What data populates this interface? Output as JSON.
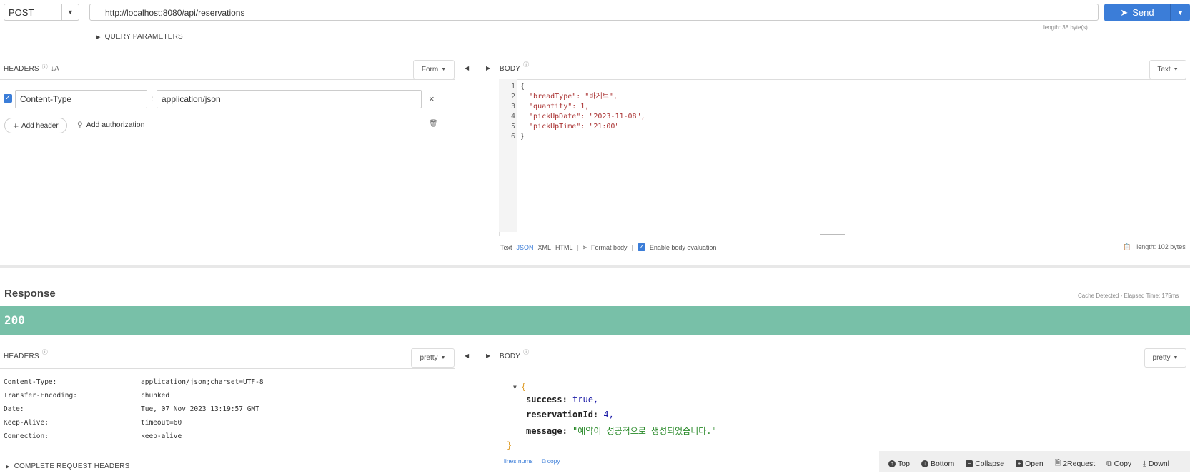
{
  "request": {
    "method": "POST",
    "url": "http://localhost:8080/api/reservations",
    "url_length": "length: 38 byte(s)",
    "send_label": "Send",
    "query_params_label": "QUERY PARAMETERS"
  },
  "req_headers": {
    "title": "HEADERS",
    "mode": "Form",
    "header_name": "Content-Type",
    "header_value": "application/json",
    "add_header_label": "Add header",
    "add_auth_label": "Add authorization"
  },
  "req_body": {
    "title": "BODY",
    "mode": "Text",
    "lines": [
      {
        "num": "1",
        "text": "{"
      },
      {
        "num": "2",
        "text": "  \"breadType\": \"바게트\","
      },
      {
        "num": "3",
        "text": "  \"quantity\": 1,"
      },
      {
        "num": "4",
        "text": "  \"pickUpDate\": \"2023-11-08\","
      },
      {
        "num": "5",
        "text": "  \"pickUpTime\": \"21:00\""
      },
      {
        "num": "6",
        "text": "}"
      }
    ],
    "format_types": [
      "Text",
      "JSON",
      "XML",
      "HTML"
    ],
    "format_body_label": "Format body",
    "eval_label": "Enable body evaluation",
    "length": "length: 102 bytes"
  },
  "response": {
    "title": "Response",
    "cache_info": "Cache Detected - Elapsed Time: 175ms",
    "status_code": "200",
    "headers_title": "HEADERS",
    "headers_mode": "pretty",
    "headers": [
      {
        "key": "Content-Type:",
        "value": "application/json;charset=UTF-8"
      },
      {
        "key": "Transfer-Encoding:",
        "value": "chunked"
      },
      {
        "key": "Date:",
        "value": "Tue, 07 Nov 2023 13:19:57 GMT"
      },
      {
        "key": "Keep-Alive:",
        "value": "timeout=60"
      },
      {
        "key": "Connection:",
        "value": "keep-alive"
      }
    ],
    "complete_headers_label": "COMPLETE REQUEST HEADERS",
    "body_title": "BODY",
    "body_mode": "pretty",
    "json": {
      "open": "{",
      "close": "}",
      "success_key": "success:",
      "success_val": "true,",
      "id_key": "reservationId:",
      "id_val": "4,",
      "message_key": "message:",
      "message_val": "\"예약이 성공적으로 생성되었습니다.\""
    },
    "lines_nums_label": "lines nums",
    "copy_label": "copy",
    "toolbar": [
      "Top",
      "Bottom",
      "Collapse",
      "Open",
      "2Request",
      "Copy",
      "Downl"
    ]
  },
  "colors": {
    "accent": "#3b7dd8",
    "status_ok": "#78c0a8"
  }
}
